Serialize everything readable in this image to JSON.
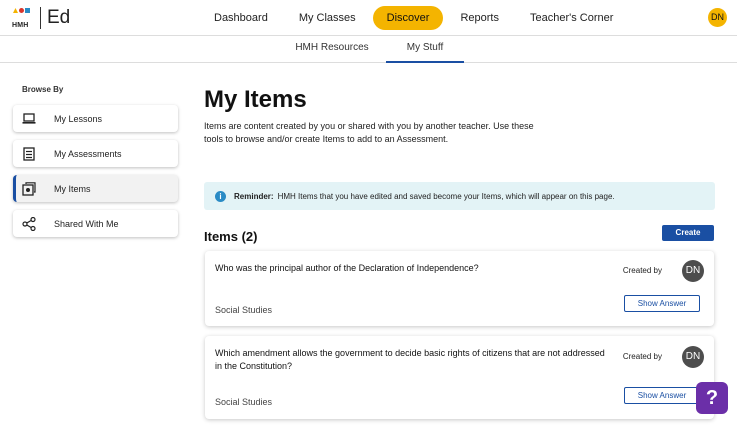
{
  "logo": {
    "brand": "HMH",
    "product": "Ed"
  },
  "nav": {
    "items": [
      {
        "label": "Dashboard"
      },
      {
        "label": "My Classes"
      },
      {
        "label": "Discover"
      },
      {
        "label": "Reports"
      },
      {
        "label": "Teacher's Corner"
      }
    ],
    "active": "Discover",
    "user_initials": "DN"
  },
  "subtabs": [
    {
      "label": "HMH Resources"
    },
    {
      "label": "My Stuff"
    }
  ],
  "sidebar": {
    "heading": "Browse By",
    "items": [
      {
        "label": "My Lessons",
        "icon": "laptop-icon"
      },
      {
        "label": "My Assessments",
        "icon": "checklist-icon"
      },
      {
        "label": "My Items",
        "icon": "items-icon"
      },
      {
        "label": "Shared With Me",
        "icon": "share-icon"
      }
    ]
  },
  "main": {
    "title": "My Items",
    "description": "Items are content created by you or shared with you by another teacher. Use these tools to browse and/or create Items to add to an Assessment.",
    "reminder": {
      "label": "Reminder:",
      "text": "HMH Items that you have edited and saved become your Items, which will appear on this page."
    },
    "items_heading": "Items (2)",
    "create_label": "Create",
    "items": [
      {
        "question": "Who was the principal author of the Declaration of Independence?",
        "created_by_label": "Created by",
        "creator_initials": "DN",
        "subject": "Social Studies",
        "show_answer_label": "Show Answer"
      },
      {
        "question": "Which amendment allows the government to decide basic rights of citizens that are not addressed in the Constitution?",
        "created_by_label": "Created by",
        "creator_initials": "DN",
        "subject": "Social Studies",
        "show_answer_label": "Show Answer"
      }
    ]
  },
  "help": {
    "label": "?"
  },
  "colors": {
    "accent": "#f4b400",
    "primary": "#1a4fa3",
    "help": "#6b2fa8"
  }
}
